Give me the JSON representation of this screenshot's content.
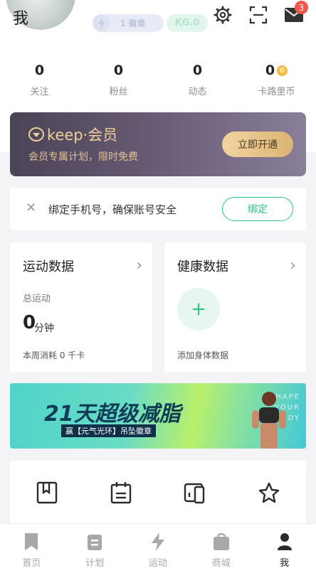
{
  "header": {
    "title": "我",
    "badge_count_text": "1 徽章",
    "kg_text": "KG.0",
    "mail_badge": "3"
  },
  "stats": [
    {
      "value": "0",
      "label": "关注"
    },
    {
      "value": "0",
      "label": "粉丝"
    },
    {
      "value": "0",
      "label": "动态"
    },
    {
      "value": "0",
      "label": "卡路里币"
    }
  ],
  "member": {
    "logo_text": "keep·会员",
    "subtitle": "会员专属计划，限时免费",
    "button_label": "立即开通"
  },
  "bind_phone": {
    "text": "绑定手机号，确保账号安全",
    "button_label": "绑定"
  },
  "sport_card": {
    "title": "运动数据",
    "total_label": "总运动",
    "total_value": "0",
    "unit": "分钟",
    "weekly": "本周消耗 0 千卡"
  },
  "health_card": {
    "title": "健康数据",
    "add_label": "添加身体数据"
  },
  "banner": {
    "headline": "21天超级减脂",
    "tagline": "赢【元气光环】吊坠徽章",
    "side_text": "SHAPE YOUR BODY"
  },
  "shortcuts": [
    "bookmark-icon",
    "calendar-icon",
    "devices-icon",
    "star-icon"
  ],
  "tabbar": [
    {
      "label": "首页",
      "icon": "bookmark-tab-icon"
    },
    {
      "label": "计划",
      "icon": "clipboard-tab-icon"
    },
    {
      "label": "运动",
      "icon": "bolt-tab-icon"
    },
    {
      "label": "商城",
      "icon": "bag-tab-icon"
    },
    {
      "label": "我",
      "icon": "person-tab-icon",
      "active": true
    }
  ],
  "colors": {
    "accent_green": "#24c789",
    "member_gold": "#e3c394",
    "badge_red": "#f0574b"
  }
}
